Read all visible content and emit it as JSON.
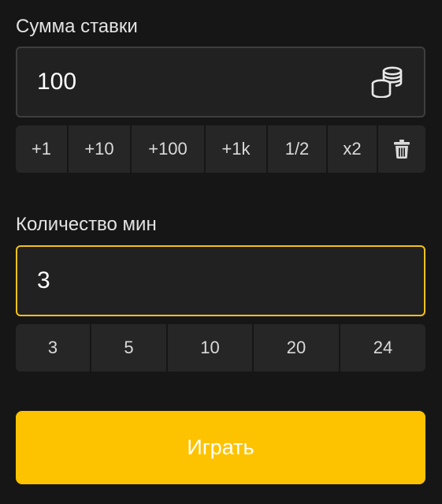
{
  "bet": {
    "label": "Сумма ставки",
    "value": "100",
    "icon": "coins-icon",
    "quick_buttons": [
      {
        "label": "+1"
      },
      {
        "label": "+10"
      },
      {
        "label": "+100"
      },
      {
        "label": "+1k"
      },
      {
        "label": "1/2"
      },
      {
        "label": "x2"
      },
      {
        "label": "",
        "icon": "trash-icon"
      }
    ]
  },
  "mines": {
    "label": "Количество мин",
    "value": "3",
    "quick_buttons": [
      {
        "label": "3"
      },
      {
        "label": "5"
      },
      {
        "label": "10"
      },
      {
        "label": "20"
      },
      {
        "label": "24"
      }
    ]
  },
  "play_button": {
    "label": "Играть"
  },
  "colors": {
    "background": "#161616",
    "field": "#212121",
    "field_border": "#3e3e3e",
    "active_border": "#f3c21a",
    "quick_button": "#262626",
    "accent": "#fdc300"
  }
}
